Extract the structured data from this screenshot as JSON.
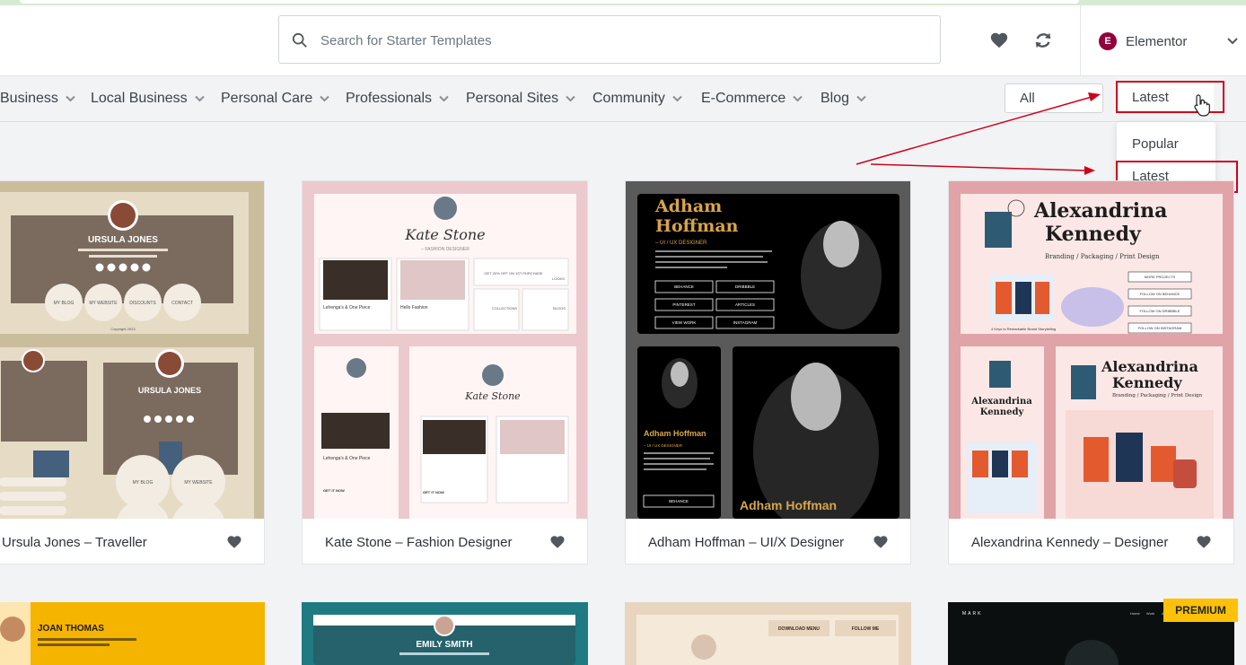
{
  "search": {
    "placeholder": "Search for Starter Templates"
  },
  "builder": {
    "badge": "E",
    "label": "Elementor"
  },
  "categories": [
    "Business",
    "Local Business",
    "Personal Care",
    "Professionals",
    "Personal Sites",
    "Community",
    "E-Commerce",
    "Blog"
  ],
  "filters": {
    "type_value": "All",
    "sort_value": "Latest"
  },
  "sort_dropdown": {
    "options": [
      "Popular",
      "Latest"
    ]
  },
  "templates": [
    {
      "title": "Ursula Jones – Traveller",
      "name_text": "URSULA JONES",
      "buttons": [
        "MY BLOG",
        "MY WEBSITE",
        "DISCOUNTS",
        "CONTACT"
      ],
      "footer_text": "Copyright 2023"
    },
    {
      "title": "Kate Stone – Fashion Designer",
      "name_text": "Kate Stone",
      "role_text": "– FASHION DESIGNER",
      "promo_text": "GET 20% OFF ON 1ST PURCHASE",
      "product1": "Lehenga's & One Piece",
      "product2": "Hello Fashion",
      "links": [
        "LOOKS",
        "COLLECTIONS",
        "BLOGS"
      ],
      "cta": "GET IT NOW"
    },
    {
      "title": "Adham Hoffman – UI/X Designer",
      "name_line1": "Adham",
      "name_line2": "Hoffman",
      "role_text": "– UI / UX DESIGNER",
      "buttons": [
        "BEHANCE",
        "DRIBBBLE",
        "PINTEREST",
        "ARTICLES",
        "VIEW WORK",
        "INSTAGRAM"
      ],
      "mobile_name": "Adham Hoffman",
      "mobile_role": "– UI / UX DESIGNER"
    },
    {
      "title": "Alexandrina Kennedy – Designer",
      "name_line1": "Alexandrina",
      "name_line2": "Kennedy",
      "role_text": "Branding / Packaging / Print Design",
      "buttons": [
        "MORE PROJECTS",
        "FOLLOW ON BEHANCE",
        "FOLLOW ON DRIBBBLE",
        "FOLLOW ON INSTAGRAM"
      ],
      "caption": "4 Keys to Remarkable Brand Storytelling"
    }
  ],
  "row2": [
    {
      "name_text": "JOAN THOMAS"
    },
    {
      "name_text": "EMILY SMITH"
    },
    {
      "labels": [
        "DOWNLOAD MENU",
        "FOLLOW ME"
      ]
    },
    {
      "brand": "MARK",
      "nav": [
        "Home",
        "Work",
        "About",
        "Contact"
      ],
      "badge": "PREMIUM"
    }
  ],
  "colors": {
    "accent_red": "#d0011b",
    "elementor": "#92003b",
    "premium": "#ffc107"
  }
}
